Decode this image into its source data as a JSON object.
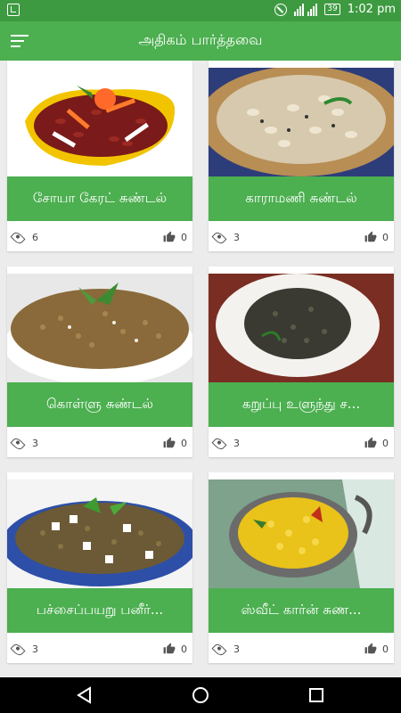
{
  "status_bar": {
    "time": "1:02 pm",
    "battery": "39"
  },
  "app_bar": {
    "title": "அதிகம் பார்த்தவை",
    "menu_icon": "hamburger-menu-icon"
  },
  "cards": [
    {
      "title": "சோயா கேரட் சுண்டல்",
      "views": "6",
      "likes": "0",
      "image": "bean-salad-photo"
    },
    {
      "title": "காராமணி சுண்டல்",
      "views": "3",
      "likes": "0",
      "image": "cowpea-sundal-photo"
    },
    {
      "title": "கொள்ளு சுண்டல்",
      "views": "3",
      "likes": "0",
      "image": "horsegram-sundal-photo"
    },
    {
      "title": "கறுப்பு உளுந்து ச...",
      "views": "3",
      "likes": "0",
      "image": "black-urad-photo"
    },
    {
      "title": "பச்சைப்பயறு பனீர்...",
      "views": "3",
      "likes": "0",
      "image": "green-gram-paneer-photo"
    },
    {
      "title": "ஸ்வீட் கார்ன் சுண...",
      "views": "3",
      "likes": "0",
      "image": "sweet-corn-photo"
    }
  ],
  "colors": {
    "status_bar": "#3d9a40",
    "app_bar": "#4caf50",
    "label": "#4caf50",
    "background": "#ececec"
  },
  "nav": {
    "icons": [
      "back-icon",
      "home-icon",
      "recents-icon"
    ]
  }
}
